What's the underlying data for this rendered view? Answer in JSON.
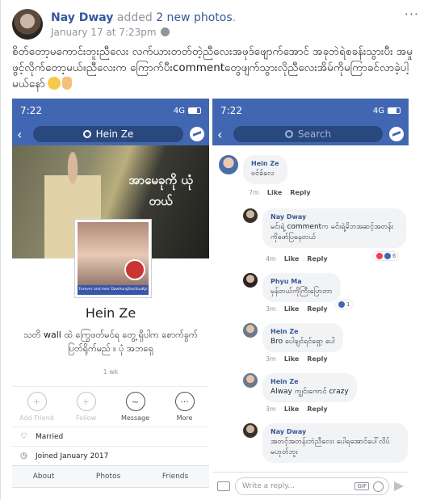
{
  "post": {
    "author": "Nay Dway",
    "action": "added",
    "photos_link": "2 new photos",
    "action_suffix": ".",
    "timestamp": "January 17 at 7:23pm",
    "more": "···",
    "caption": "စိတ်တော့မကောင်းဘူးညီလေး လက်ယားတတ်တဲ့ညီလေးအဖုဒ်ဖျောက်အောင် အခုဘဲရဲစခန်းသွားပီး အမှုဖွင့်လိုက်တော့မယ်။ညီလေးက ကြောက်ပီးcommentတွေဖျက်သွားလိုညီလေးအိမ်ကိုမကြာခင်လာခဲ့ပါ့မယ်နော်"
  },
  "left_screen": {
    "time": "7:22",
    "network": "4G",
    "search_text": "Hein Ze",
    "cover_text": "အာမေခုကို ယုံတယ်",
    "frame_text": "Forever and ever DawAungSanSuuKyi",
    "profile_name": "Hein Ze",
    "bio": "သတိ wall ထဲ ကြွေဖတ်မင်ရ တွေ့ ရှိပါက စောက်ခွက်ပြတ်ရိုက်မည် ။ ပုံ အဘရှေ",
    "bio_age": "1 wk",
    "actions": [
      {
        "label": "Add Friend",
        "icon": "add-friend-icon",
        "glyph": "+"
      },
      {
        "label": "Follow",
        "icon": "follow-icon",
        "glyph": "+"
      },
      {
        "label": "Message",
        "icon": "messenger-icon",
        "glyph": "~"
      },
      {
        "label": "More",
        "icon": "more-icon",
        "glyph": "···"
      }
    ],
    "info": [
      {
        "text": "Married",
        "icon": "heart-icon",
        "glyph": "♡"
      },
      {
        "text": "Joined January 2017",
        "icon": "clock-icon",
        "glyph": "◷"
      }
    ],
    "tabs": [
      "About",
      "Photos",
      "Friends"
    ]
  },
  "right_screen": {
    "time": "7:22",
    "network": "4G",
    "search_placeholder": "Search",
    "comments": [
      {
        "name": "Hein Ze",
        "text": "ဗင်ခ်လေ",
        "time": "7m",
        "like": "Like",
        "reply": "Reply"
      },
      {
        "name": "Nay Dway",
        "text": "မင်းရဲ့ commentက မင်းရဲ့မိဘအဆင့်အတန်းကိုဖော်ပြနေတယ်",
        "time": "4m",
        "like": "Like",
        "reply": "Reply",
        "reactions": "6"
      },
      {
        "name": "Phyu Ma",
        "text": "မှန်တယ်ကိုကြီးပြောတာ",
        "time": "3m",
        "like": "Like",
        "reply": "Reply",
        "reactions": "1"
      },
      {
        "name": "Hein Ze",
        "text": "Bro ပေါချင်ရင်ရှော့ ပေါ",
        "time": "3m",
        "like": "Like",
        "reply": "Reply"
      },
      {
        "name": "Hein Ze",
        "text": "Alway ကျွင်းကောင် crazy",
        "time": "3m",
        "like": "Like",
        "reply": "Reply"
      },
      {
        "name": "Nay Dway",
        "text": "အတင့်အတန်းဘဲညီလေး ပေါရအောင်ပေါ်လိပ်မဟုတ်ဘူး",
        "time": "",
        "like": "",
        "reply": ""
      }
    ],
    "compose_placeholder": "Write a reply...",
    "gif_label": "GIF"
  },
  "colors": {
    "brand": "#4267b2",
    "link": "#365899"
  }
}
